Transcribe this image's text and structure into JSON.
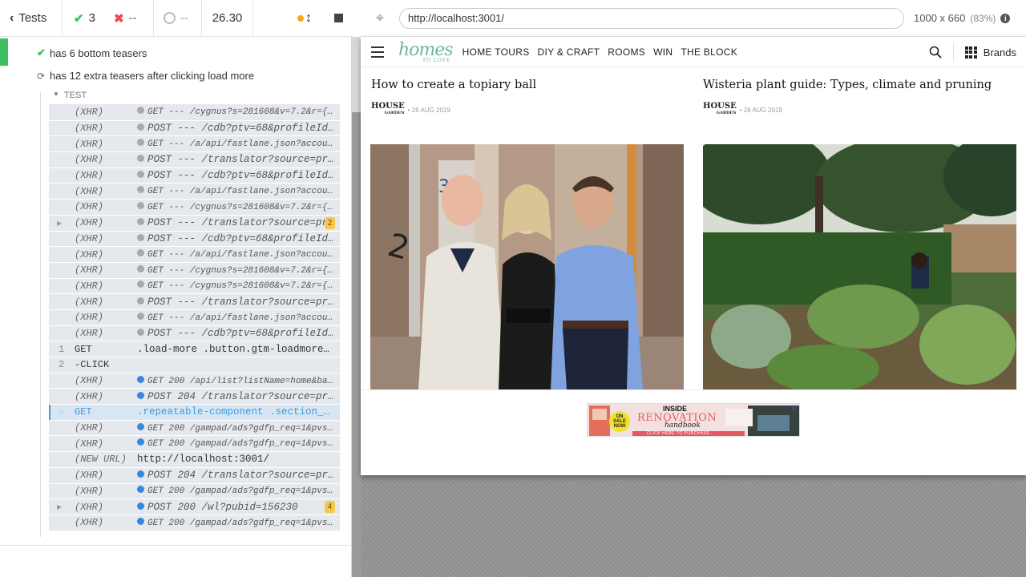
{
  "reporter": {
    "tests_label": "Tests",
    "passed_count": "3",
    "failed_count": "--",
    "pending_count": "--",
    "duration": "26.30",
    "tests": [
      {
        "label": "has 6 bottom teasers",
        "state": "passed"
      },
      {
        "label": "has 12 extra teasers after clicking load more",
        "state": "running"
      }
    ],
    "test_section_label": "TEST",
    "commands": [
      {
        "num": "",
        "name": "(XHR)",
        "msg": "GET --- /cygnus?s=281608&v=7.2&r={\"id...",
        "dot": "grey",
        "size": "small"
      },
      {
        "num": "",
        "name": "(XHR)",
        "msg": "POST --- /cdb?ptv=68&profileId=...",
        "dot": "grey",
        "size": "big"
      },
      {
        "num": "",
        "name": "(XHR)",
        "msg": "GET --- /a/api/fastlane.json?account_...",
        "dot": "grey",
        "size": "small"
      },
      {
        "num": "",
        "name": "(XHR)",
        "msg": "POST --- /translator?source=pre...",
        "dot": "grey",
        "size": "big"
      },
      {
        "num": "",
        "name": "(XHR)",
        "msg": "POST --- /cdb?ptv=68&profileId=...",
        "dot": "grey",
        "size": "big"
      },
      {
        "num": "",
        "name": "(XHR)",
        "msg": "GET --- /a/api/fastlane.json?account_...",
        "dot": "grey",
        "size": "small"
      },
      {
        "num": "",
        "name": "(XHR)",
        "msg": "GET --- /cygnus?s=281608&v=7.2&r={\"id...",
        "dot": "grey",
        "size": "small"
      },
      {
        "num": "",
        "name": "(XHR)",
        "msg": "POST --- /translator?source=pr...",
        "dot": "grey",
        "size": "big",
        "badge": "2",
        "expander": true
      },
      {
        "num": "",
        "name": "(XHR)",
        "msg": "POST --- /cdb?ptv=68&profileId=...",
        "dot": "grey",
        "size": "big"
      },
      {
        "num": "",
        "name": "(XHR)",
        "msg": "GET --- /a/api/fastlane.json?account_...",
        "dot": "grey",
        "size": "small"
      },
      {
        "num": "",
        "name": "(XHR)",
        "msg": "GET --- /cygnus?s=281608&v=7.2&r={\"id...",
        "dot": "grey",
        "size": "small"
      },
      {
        "num": "",
        "name": "(XHR)",
        "msg": "GET --- /cygnus?s=281608&v=7.2&r={\"id...",
        "dot": "grey",
        "size": "small"
      },
      {
        "num": "",
        "name": "(XHR)",
        "msg": "POST --- /translator?source=pre...",
        "dot": "grey",
        "size": "big"
      },
      {
        "num": "",
        "name": "(XHR)",
        "msg": "GET --- /a/api/fastlane.json?account_...",
        "dot": "grey",
        "size": "small"
      },
      {
        "num": "",
        "name": "(XHR)",
        "msg": "POST --- /cdb?ptv=68&profileId=...",
        "dot": "grey",
        "size": "big"
      },
      {
        "num": "1",
        "name": "GET",
        "msg": ".load-more .button.gtm-loadmore-b...",
        "dot": "",
        "size": "big",
        "plain": true
      },
      {
        "num": "2",
        "name": "-CLICK",
        "msg": "",
        "dot": "",
        "size": "big",
        "plain": true
      },
      {
        "num": "",
        "name": "(XHR)",
        "msg": "GET 200 /api/list?listName=home&baseP...",
        "dot": "blue",
        "size": "small"
      },
      {
        "num": "",
        "name": "(XHR)",
        "msg": "POST 204 /translator?source=pre...",
        "dot": "blue",
        "size": "big"
      },
      {
        "num": "",
        "name": "GET",
        "msg": ".repeatable-component .section__r...",
        "dot": "",
        "size": "big",
        "active": true
      },
      {
        "num": "",
        "name": "(XHR)",
        "msg": "GET 200 /gampad/ads?gdfp_req=1&pvsid=...",
        "dot": "blue",
        "size": "small"
      },
      {
        "num": "",
        "name": "(XHR)",
        "msg": "GET 200 /gampad/ads?gdfp_req=1&pvsid=...",
        "dot": "blue",
        "size": "small"
      },
      {
        "num": "",
        "name": "(NEW URL)",
        "msg": "http://localhost:3001/",
        "dot": "",
        "size": "big",
        "newurl": true
      },
      {
        "num": "",
        "name": "(XHR)",
        "msg": "POST 204 /translator?source=pre...",
        "dot": "blue",
        "size": "big"
      },
      {
        "num": "",
        "name": "(XHR)",
        "msg": "GET 200 /gampad/ads?gdfp_req=1&pvsid=...",
        "dot": "blue",
        "size": "small"
      },
      {
        "num": "",
        "name": "(XHR)",
        "msg": "POST 200 /wl?pubid=156230",
        "dot": "blue",
        "size": "big",
        "badge": "4",
        "expander": true
      },
      {
        "num": "",
        "name": "(XHR)",
        "msg": "GET 200 /gampad/ads?gdfp_req=1&pvsid=...",
        "dot": "blue",
        "size": "small"
      }
    ]
  },
  "aut": {
    "url": "http://localhost:3001/",
    "viewport": "1000 x 660",
    "scale": "(83%)",
    "site": {
      "logo": "homes",
      "logo_sub": "TO LOVE",
      "nav": [
        "HOME TOURS",
        "DIY & CRAFT",
        "ROOMS",
        "WIN",
        "THE BLOCK"
      ],
      "brands_label": "Brands",
      "cards": [
        {
          "title": "How to create a topiary ball",
          "brand": "HOUSE",
          "brand_sub": "GARDEN",
          "date": "• 26 AUG 2019"
        },
        {
          "title": "Wisteria plant guide: Types, climate and pruning",
          "brand": "HOUSE",
          "brand_sub": "GARDEN",
          "date": "• 26 AUG 2019"
        }
      ],
      "ad": {
        "headline_top": "INSIDE",
        "headline": "RENOVATION",
        "headline_sub": "handbook",
        "badge": "ON SALE NOW",
        "cta": "CLICK HERE TO PURCHASE"
      }
    }
  },
  "colors": {
    "pass": "#3cbf63",
    "fail": "#e94f4f",
    "pending": "#f5a623",
    "xhr_blue": "#3b87d8",
    "accent_blue": "#3d9bd8",
    "logo_green": "#6fb5a3"
  }
}
